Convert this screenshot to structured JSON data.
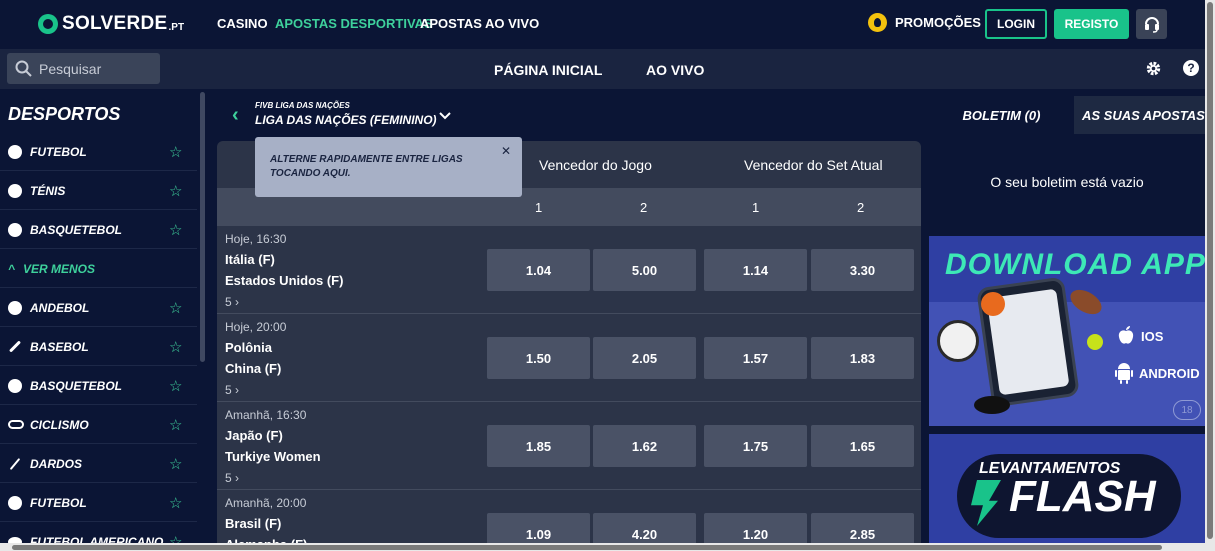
{
  "header": {
    "logo": "SOLVERDE",
    "logo_suffix": ".PT",
    "nav": [
      "CASINO",
      "APOSTAS DESPORTIVAS",
      "APOSTAS AO VIVO"
    ],
    "promotions": "PROMOÇÕES",
    "login": "LOGIN",
    "register": "REGISTO",
    "accent_color": "#19c38a"
  },
  "subbar": {
    "search_placeholder": "Pesquisar",
    "home": "PÁGINA INICIAL",
    "live": "AO VIVO"
  },
  "sidebar": {
    "title": "DESPORTOS",
    "items": [
      {
        "label": "FUTEBOL",
        "icon": "soccer-ball-icon"
      },
      {
        "label": "TÉNIS",
        "icon": "tennis-ball-icon"
      },
      {
        "label": "BASQUETEBOL",
        "icon": "basketball-icon"
      },
      {
        "label": "VER MENOS",
        "icon": "chevron-up-icon"
      },
      {
        "label": "ANDEBOL",
        "icon": "handball-icon"
      },
      {
        "label": "BASEBOL",
        "icon": "baseball-bat-icon"
      },
      {
        "label": "BASQUETEBOL",
        "icon": "basketball-icon"
      },
      {
        "label": "CICLISMO",
        "icon": "bicycle-icon"
      },
      {
        "label": "DARDOS",
        "icon": "dart-icon"
      },
      {
        "label": "FUTEBOL",
        "icon": "soccer-ball-icon"
      },
      {
        "label": "FUTEBOL AMERICANO",
        "icon": "american-football-icon"
      }
    ]
  },
  "league": {
    "category": "FIVB LIGA DAS NAÇÕES",
    "name": "LIGA DAS NAÇÕES (FEMININO)"
  },
  "tooltip": {
    "text": "ALTERNE RAPIDAMENTE ENTRE LIGAS TOCANDO AQUI."
  },
  "table": {
    "market1": "Vencedor do Jogo",
    "market2": "Vencedor do Set Atual",
    "sub": [
      "1",
      "2",
      "1",
      "2"
    ],
    "events": [
      {
        "time": "Hoje, 16:30",
        "home": "Itália (F)",
        "away": "Estados Unidos (F)",
        "more": "5",
        "odds": [
          "1.04",
          "5.00",
          "1.14",
          "3.30"
        ]
      },
      {
        "time": "Hoje, 20:00",
        "home": "Polônia",
        "away": "China (F)",
        "more": "5",
        "odds": [
          "1.50",
          "2.05",
          "1.57",
          "1.83"
        ]
      },
      {
        "time": "Amanhã, 16:30",
        "home": "Japão (F)",
        "away": "Turkiye Women",
        "more": "5",
        "odds": [
          "1.85",
          "1.62",
          "1.75",
          "1.65"
        ]
      },
      {
        "time": "Amanhã, 20:00",
        "home": "Brasil (F)",
        "away": "Alemanha (F)",
        "more": "5",
        "odds": [
          "1.09",
          "4.20",
          "1.20",
          "2.85"
        ]
      }
    ]
  },
  "betslip": {
    "tab1": "BOLETIM (0)",
    "tab2": "AS SUAS APOSTAS ...",
    "empty": "O seu boletim está vazio"
  },
  "banners": {
    "app_title": "DOWNLOAD APP",
    "ios": "IOS",
    "android": "ANDROID",
    "age": "18",
    "flash_small": "LEVANTAMENTOS",
    "flash_big": "FLASH"
  }
}
